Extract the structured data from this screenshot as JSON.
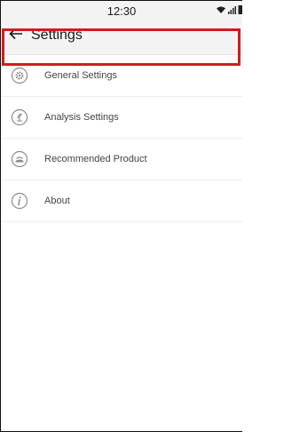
{
  "status_bar": {
    "time": "12:30",
    "icons": [
      "wifi-icon",
      "signal-icon",
      "battery-icon"
    ]
  },
  "header": {
    "back_icon": "back-arrow-icon",
    "title": "Settings"
  },
  "menu": {
    "items": [
      {
        "label": "General Settings",
        "icon": "gear-icon"
      },
      {
        "label": "Analysis Settings",
        "icon": "analysis-icon"
      },
      {
        "label": "Recommended Product",
        "icon": "product-icon"
      },
      {
        "label": "About",
        "icon": "info-icon"
      }
    ]
  },
  "colors": {
    "highlight": "#d71920",
    "header_bg": "#f3f3f3",
    "icon": "#8a8a8a"
  }
}
